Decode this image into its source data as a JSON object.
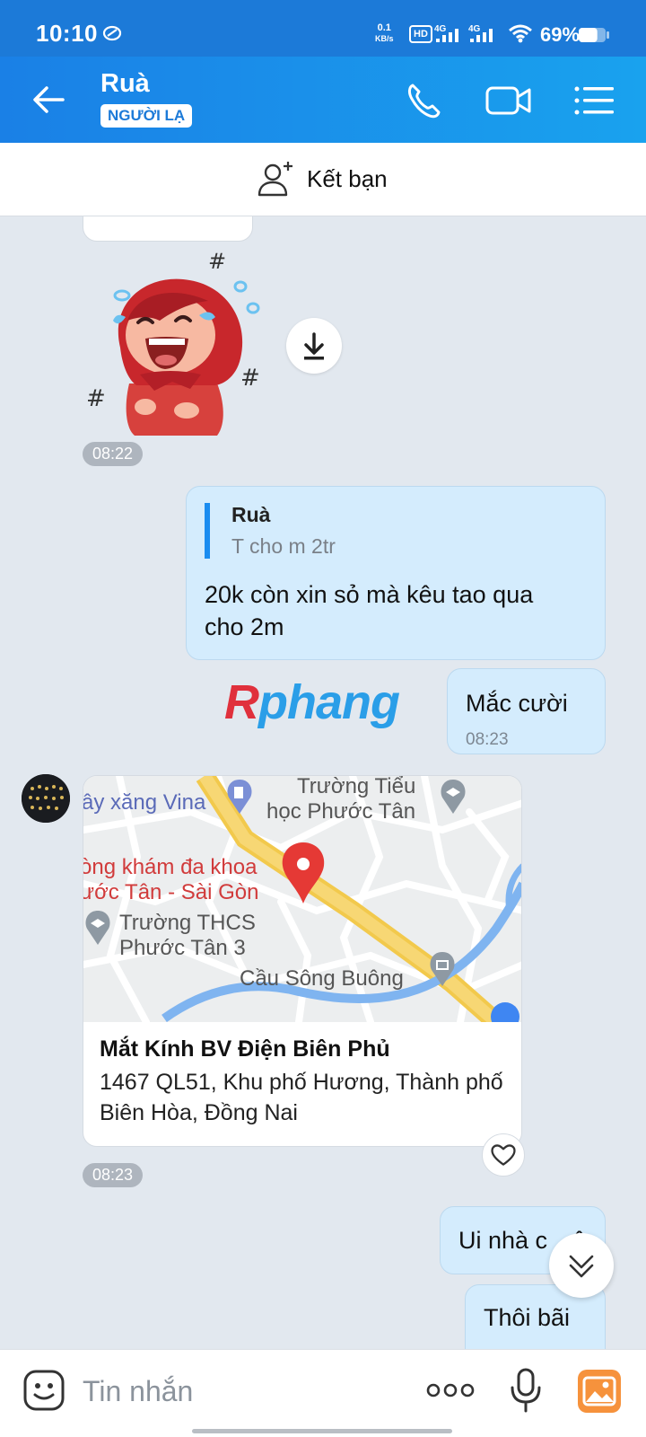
{
  "status_bar": {
    "time": "10:10",
    "net_speed_value": "0.1",
    "net_speed_unit": "KB/s",
    "hd": "HD",
    "sim1": "4G",
    "sim2": "4G",
    "battery": "69%",
    "battery_level": 0.69
  },
  "header": {
    "contact_name": "Ruà",
    "badge": "NGƯỜI LẠ"
  },
  "add_friend": {
    "label": "Kết bạn"
  },
  "messages": {
    "sticker_time": "08:22",
    "reply": {
      "quote_name": "Ruà",
      "quote_text": "T cho m 2tr",
      "text_line1": "20k còn xin sỏ mà kêu tao qua",
      "text_line2": "cho 2m"
    },
    "laugh": {
      "text": "Mắc cười",
      "time": "08:23"
    },
    "location": {
      "map_labels": {
        "gas": "ây xăng Vina",
        "school1_a": "Trường Tiểu",
        "school1_b": "học Phước Tân",
        "clinic_a": "òng khám đa khoa",
        "clinic_b": "ước Tân - Sài Gòn",
        "school2_a": "Trường THCS",
        "school2_b": "Phước Tân 3",
        "bridge": "Cầu Sông Buông"
      },
      "place": "Mắt Kính BV Điện Biên Phủ",
      "address": "1467 QL51, Khu phố Hương, Thành phố Biên Hòa, Đồng Nai",
      "time": "08:23"
    },
    "partial1": "Ui nhà c",
    "partial1_tail": "ô",
    "partial2": "Thôi bãi"
  },
  "watermark": {
    "r": "R",
    "rest": "phang"
  },
  "input": {
    "placeholder": "Tin nhắn"
  },
  "colors": {
    "header_start": "#1a80e6",
    "header_end": "#19a2ee",
    "my_bubble": "#d4ecfd",
    "chat_bg": "#e2e8ef",
    "map_pin": "#e53935"
  }
}
